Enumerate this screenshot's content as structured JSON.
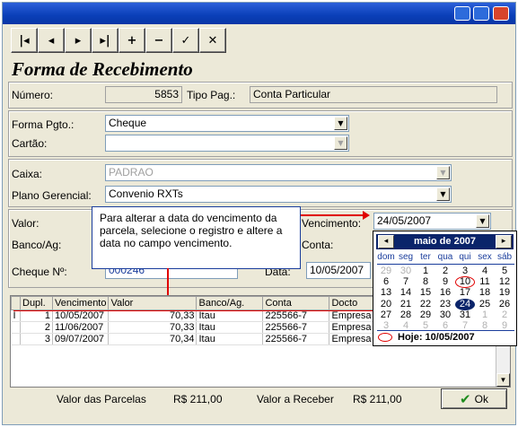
{
  "toolbar": {
    "buttons": [
      {
        "name": "first-record-button",
        "glyph": "|◂"
      },
      {
        "name": "prev-record-button",
        "glyph": "◂"
      },
      {
        "name": "next-record-button",
        "glyph": "▸"
      },
      {
        "name": "last-record-button",
        "glyph": "▸|"
      },
      {
        "name": "insert-button",
        "glyph": "+"
      },
      {
        "name": "delete-button",
        "glyph": "−"
      },
      {
        "name": "post-button",
        "glyph": "✓"
      },
      {
        "name": "cancel-button",
        "glyph": "✕"
      }
    ]
  },
  "form_title": "Forma de Recebimento",
  "header": {
    "numero_label": "Número:",
    "numero_value": "5853",
    "tipo_label": "Tipo Pag.:",
    "tipo_value": "Conta Particular"
  },
  "payment": {
    "forma_label": "Forma Pgto.:",
    "forma_value": "Cheque",
    "cartao_label": "Cartão:",
    "cartao_value": ""
  },
  "accounts": {
    "caixa_label": "Caixa:",
    "caixa_value": "PADRAO",
    "plano_label": "Plano Gerencial:",
    "plano_value": "Convenio RXTs"
  },
  "details": {
    "valor_label": "Valor:",
    "banco_label": "Banco/Ag:",
    "vencimento_label": "Vencimento:",
    "vencimento_value": "24/05/2007",
    "conta_label": "Conta:",
    "cheque_label": "Cheque Nº:",
    "cheque_value": "000246",
    "data_label": "Data:",
    "data_value": "10/05/2007"
  },
  "tooltip": "Para alterar a data do vencimento da parcela, selecione o registro e altere a data no campo vencimento.",
  "grid": {
    "columns": [
      "Dupl.",
      "Vencimento",
      "Valor",
      "Banco/Ag.",
      "Conta",
      "Docto"
    ],
    "rows": [
      {
        "marker": "I",
        "dupl": "1",
        "vencimento": "10/05/2007",
        "valor": "70,33",
        "banco": "Itau",
        "conta": "225566-7",
        "docto": "Empresa M"
      },
      {
        "marker": "",
        "dupl": "2",
        "vencimento": "11/06/2007",
        "valor": "70,33",
        "banco": "Itau",
        "conta": "225566-7",
        "docto": "Empresa M"
      },
      {
        "marker": "",
        "dupl": "3",
        "vencimento": "09/07/2007",
        "valor": "70,34",
        "banco": "Itau",
        "conta": "225566-7",
        "docto": "Empresa M"
      }
    ]
  },
  "calendar": {
    "month_label": "maio de 2007",
    "prev_glyph": "◂",
    "next_glyph": "▸",
    "weekdays": [
      "dom",
      "seg",
      "ter",
      "qua",
      "qui",
      "sex",
      "sáb"
    ],
    "weeks": [
      [
        "29",
        "30",
        "1",
        "2",
        "3",
        "4",
        "5"
      ],
      [
        "6",
        "7",
        "8",
        "9",
        "10",
        "11",
        "12"
      ],
      [
        "13",
        "14",
        "15",
        "16",
        "17",
        "18",
        "19"
      ],
      [
        "20",
        "21",
        "22",
        "23",
        "24",
        "25",
        "26"
      ],
      [
        "27",
        "28",
        "29",
        "30",
        "31",
        "1",
        "2"
      ],
      [
        "3",
        "4",
        "5",
        "6",
        "7",
        "8",
        "9"
      ]
    ],
    "selected_day": "24",
    "today_day": "10",
    "today_label": "Hoje: 10/05/2007"
  },
  "footer": {
    "parcelas_label": "Valor das Parcelas",
    "parcelas_value": "R$ 211,00",
    "receber_label": "Valor a Receber",
    "receber_value": "R$ 211,00",
    "ok_label": "Ok"
  },
  "colors": {
    "accent": "#0a246a",
    "title_bar": "#0a3fb8",
    "highlight_red": "#e00000",
    "ok_check": "#1e8c1e"
  }
}
